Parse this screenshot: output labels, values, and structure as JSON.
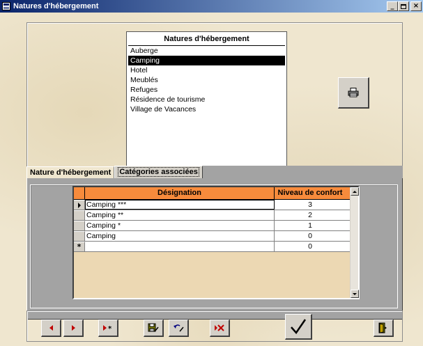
{
  "window": {
    "title": "Natures d'hébergement",
    "controls": [
      "minimize",
      "maximize",
      "close"
    ]
  },
  "list": {
    "header": "Natures d'hébergement",
    "items": [
      "Auberge",
      "Camping",
      "Hotel",
      "Meublés",
      "Refuges",
      "Résidence de tourisme",
      "Village de Vacances"
    ],
    "selected": "Camping"
  },
  "print_button": {
    "icon": "printer-icon"
  },
  "tabs": [
    {
      "label": "Nature d'hébergement",
      "active": false
    },
    {
      "label": "Catégories associées",
      "active": true
    }
  ],
  "grid": {
    "columns": [
      "Désignation",
      "Niveau de confort"
    ],
    "rows": [
      {
        "designation": "Camping ***",
        "niveau": "3",
        "current": true
      },
      {
        "designation": "Camping **",
        "niveau": "2",
        "current": false
      },
      {
        "designation": "Camping *",
        "niveau": "1",
        "current": false
      },
      {
        "designation": "Camping",
        "niveau": "0",
        "current": false
      }
    ],
    "new_row": {
      "marker": "*",
      "designation": "",
      "niveau": "0"
    },
    "header_color": "#f78b3c"
  },
  "toolbar": {
    "buttons": [
      "previous-record",
      "next-record",
      "new-record",
      "save-record",
      "undo",
      "delete-record",
      "validate",
      "exit"
    ]
  },
  "colors": {
    "titlebar": "#0a246a",
    "background": "#efe6cf",
    "selection": "#000000",
    "nav_arrow": "#c00000"
  }
}
